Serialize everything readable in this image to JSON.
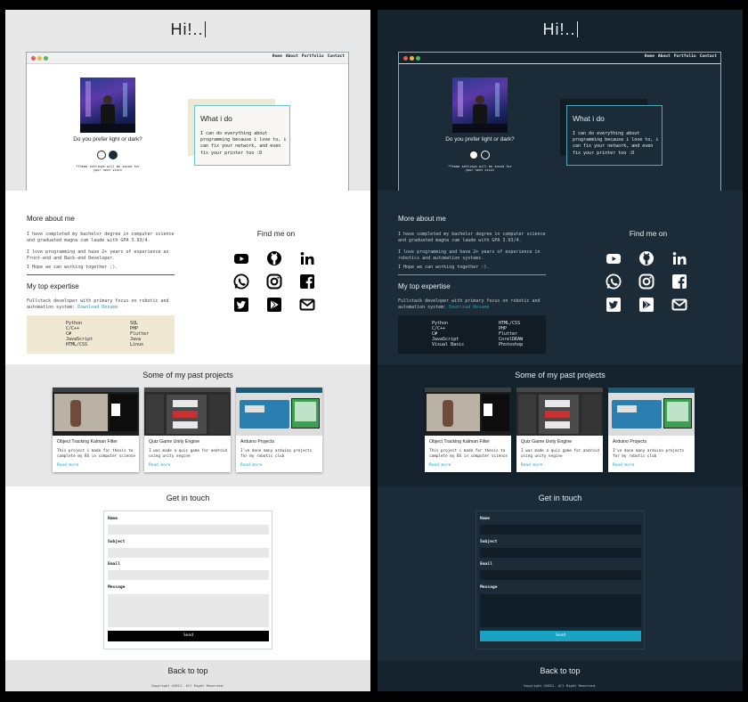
{
  "greeting": "Hi!..",
  "window_controls": {
    "close_color": "#ee5a52",
    "minimize_color": "#f2b43c",
    "maximize_color": "#47c04c"
  },
  "nav": {
    "items": [
      "Home",
      "About",
      "Portfolio",
      "Contact"
    ]
  },
  "theme": {
    "question": "Do you prefer light or dark?",
    "options": [
      "light",
      "dark"
    ],
    "note": "*Theme settings will be saved for your next visit"
  },
  "what_i_do": {
    "title": "What i do",
    "text": "I can do everything about programming because i love to, i can fix your network, and even fix your printer too :D"
  },
  "about": {
    "title": "More about me",
    "paragraphs": [
      "I have completed my bachelor degree in computer science and graduated magna cum laude with GPA 3.93/4.",
      "I love programming and have 2+ years of experience as Front-end and Back-end Developer.",
      "I Hope we can working together :)."
    ],
    "paragraphs_dark": [
      "I have completed my bachelor degree in computer science and graduated magna cum laude with GPA 3.93/4.",
      "I love programming and have 2+ years of experience in robotics and automation systems.",
      "I Hope we can working together :)."
    ]
  },
  "expertise": {
    "title": "My top expertise",
    "text": "Fullstack developer with primary focus on robotic and automation system:",
    "resume_link": "Download Resume",
    "skills_left": [
      "Python",
      "C/C++",
      "C#",
      "JavaScript",
      "HTML/CSS"
    ],
    "skills_right": [
      "SQL",
      "PHP",
      "Flutter",
      "Java",
      "Linux"
    ],
    "skills_left_dark": [
      "Python",
      "C/C++",
      "C#",
      "JavaScript",
      "Visual Basic"
    ],
    "skills_right_dark": [
      "HTML/CSS",
      "PHP",
      "Flutter",
      "CorelDRAW",
      "Photoshop"
    ]
  },
  "find_me": {
    "title": "Find me on",
    "icons": [
      "youtube-icon",
      "github-icon",
      "linkedin-icon",
      "whatsapp-icon",
      "instagram-icon",
      "facebook-icon",
      "twitter-icon",
      "google-play-icon",
      "email-icon"
    ]
  },
  "projects": {
    "title": "Some of my past projects",
    "items": [
      {
        "title": "Object Tracking Kalman Filter",
        "desc": "This project i made for thesis to complete my BS in computer science",
        "link": "Read more"
      },
      {
        "title": "Quiz Game Unity Engine",
        "desc": "I was made a quiz game for android using unity engine",
        "link": "Read more"
      },
      {
        "title": "Arduino Projects",
        "desc": "I've done many arduino projects for my robotic club",
        "link": "Read more"
      }
    ]
  },
  "contact": {
    "title": "Get in touch",
    "labels": {
      "name": "Name",
      "subject": "Subject",
      "email": "Email",
      "message": "Message"
    },
    "send": "Send"
  },
  "footer": {
    "back_to_top": "Back to top",
    "copyright": "Copyright ©2021. All Right Reserved."
  },
  "colors": {
    "accent": "#19a3c2",
    "light_bg": "#e8e8e8",
    "dark_bg": "#14232d",
    "skill_light": "#efe8d3"
  }
}
